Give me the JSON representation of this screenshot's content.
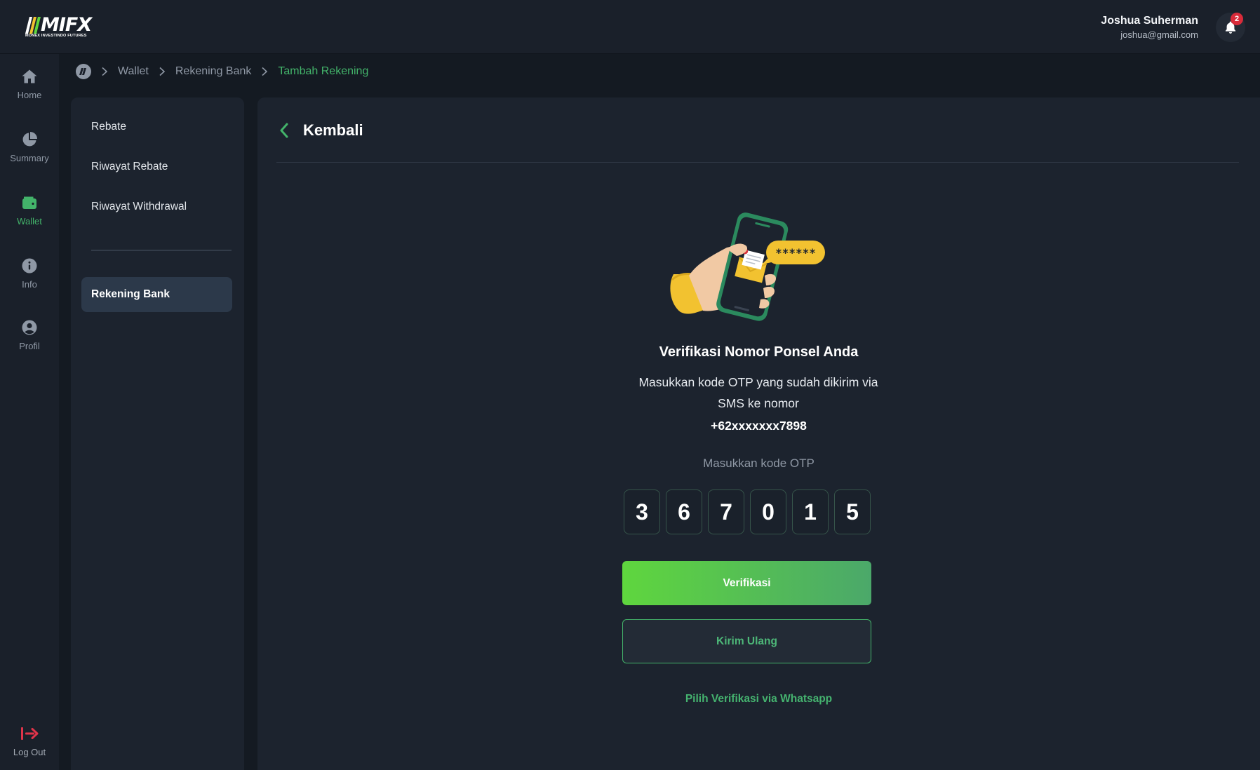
{
  "brand": {
    "logo_text": "MIFX",
    "logo_subtitle": "MONEX INVESTINDO FUTURES"
  },
  "header": {
    "user_name": "Joshua Suherman",
    "user_email": "joshua@gmail.com",
    "notification_count": "2"
  },
  "rail": {
    "items": [
      {
        "label": "Home",
        "icon": "home-icon"
      },
      {
        "label": "Summary",
        "icon": "pie-chart-icon"
      },
      {
        "label": "Wallet",
        "icon": "wallet-icon"
      },
      {
        "label": "Info",
        "icon": "info-icon"
      },
      {
        "label": "Profil",
        "icon": "user-circle-icon"
      }
    ],
    "active": "Wallet",
    "logout_label": "Log Out"
  },
  "breadcrumb": {
    "items": [
      "Wallet",
      "Rekening Bank",
      "Tambah Rekening"
    ]
  },
  "subnav": {
    "items": [
      "Rebate",
      "Riwayat Rebate",
      "Riwayat Withdrawal"
    ],
    "active_item": "Rekening Bank"
  },
  "main": {
    "back_label": "Kembali",
    "illustration_code": "******",
    "title": "Verifikasi Nomor Ponsel Anda",
    "description": "Masukkan kode OTP yang sudah dikirim via SMS ke nomor",
    "phone": "+62xxxxxxx7898",
    "otp_label": "Masukkan kode OTP",
    "otp_digits": [
      "3",
      "6",
      "7",
      "0",
      "1",
      "5"
    ],
    "verify_button": "Verifikasi",
    "resend_button": "Kirim Ulang",
    "whatsapp_link": "Pilih Verifikasi via Whatsapp"
  },
  "colors": {
    "accent_green": "#43b36a",
    "logout_red": "#e0344a",
    "badge_red": "#d92b3a"
  }
}
